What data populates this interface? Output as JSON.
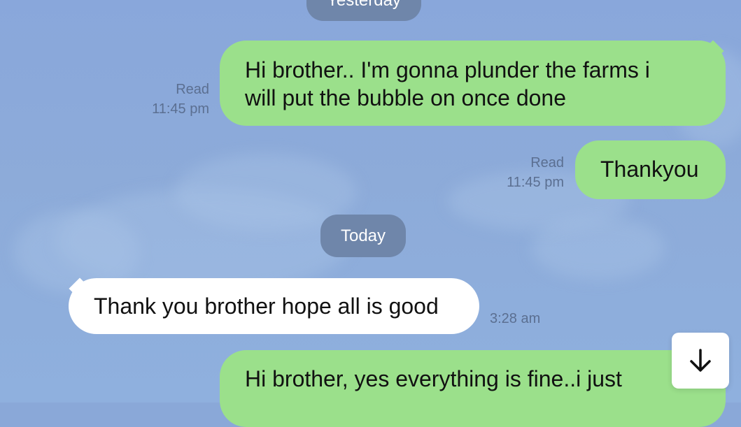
{
  "dividers": {
    "yesterday": "Yesterday",
    "today": "Today"
  },
  "messages": [
    {
      "direction": "outgoing",
      "text_lines": [
        "Hi brother.. I'm gonna plunder the farms i",
        "will put the bubble on once done"
      ],
      "read_label": "Read",
      "time": "11:45 pm"
    },
    {
      "direction": "outgoing",
      "text_lines": [
        "Thankyou"
      ],
      "read_label": "Read",
      "time": "11:45 pm"
    },
    {
      "direction": "incoming",
      "text_lines": [
        "Thank you brother hope all is good"
      ],
      "time": "3:28 am"
    },
    {
      "direction": "outgoing",
      "text_lines": [
        "Hi brother, yes everything is fine..i just"
      ]
    }
  ],
  "controls": {
    "scroll_to_bottom_icon": "arrow-down-icon"
  },
  "colors": {
    "background": "#8aa8d8",
    "outgoing_bubble": "#9be08b",
    "incoming_bubble": "#ffffff",
    "date_chip": "#6f86aa",
    "meta_text": "#5b6f91"
  }
}
